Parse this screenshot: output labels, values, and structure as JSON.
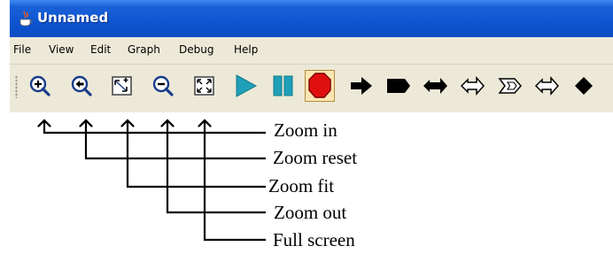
{
  "window": {
    "title": "Unnamed",
    "icon": "java-cup-icon"
  },
  "menu": [
    "File",
    "View",
    "Edit",
    "Graph",
    "Debug",
    "Help"
  ],
  "toolbar": {
    "buttons": [
      {
        "name": "zoom-in",
        "icon": "magnifier-plus-icon"
      },
      {
        "name": "zoom-reset",
        "icon": "magnifier-left-arrow-icon"
      },
      {
        "name": "zoom-fit",
        "icon": "fit-arrows-icon"
      },
      {
        "name": "zoom-out",
        "icon": "magnifier-minus-icon"
      },
      {
        "name": "full-screen",
        "icon": "expand-corners-icon"
      },
      {
        "name": "play",
        "icon": "play-icon"
      },
      {
        "name": "pause",
        "icon": "pause-icon"
      },
      {
        "name": "stop",
        "icon": "stop-octagon-icon",
        "pressed": true
      },
      {
        "name": "step-arrow",
        "icon": "right-arrow-icon"
      },
      {
        "name": "step-flag",
        "icon": "flag-arrow-icon"
      },
      {
        "name": "step-back-arrow",
        "icon": "double-head-arrow-icon"
      },
      {
        "name": "outline-arrow",
        "icon": "outline-double-arrow-icon"
      },
      {
        "name": "outline-arrow-2",
        "icon": "outline-flag-arrow-icon"
      },
      {
        "name": "outline-arrow-3",
        "icon": "outline-double-arrow-icon"
      },
      {
        "name": "diamond",
        "icon": "diamond-icon"
      }
    ]
  },
  "annotations": [
    "Zoom in",
    "Zoom reset",
    "Zoom fit",
    "Zoom out",
    "Full screen"
  ],
  "colors": {
    "titlebar": "#0d54d0",
    "toolbar_bg": "#ece9d8",
    "play": "#1ea0b8",
    "stop": "#e01010",
    "stop_bg": "#fbe6b3"
  }
}
